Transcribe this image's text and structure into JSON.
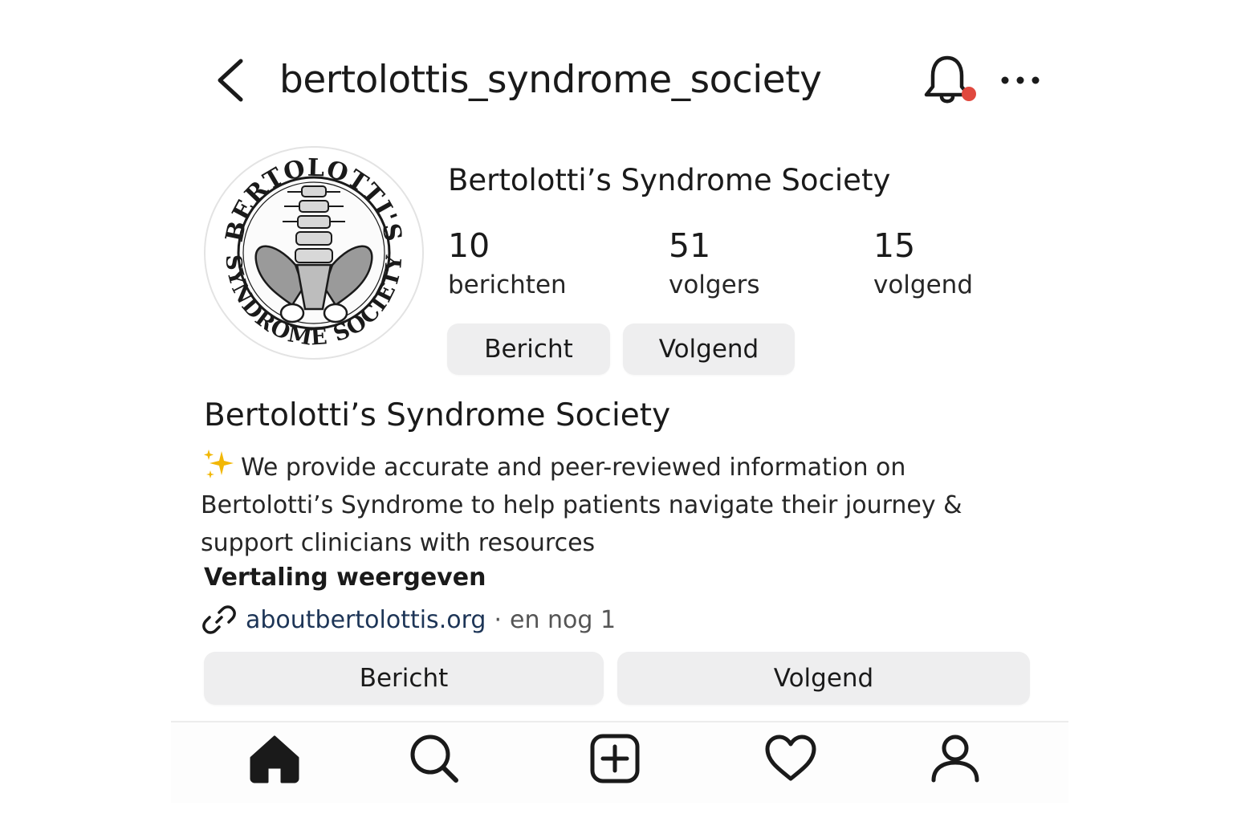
{
  "header": {
    "username": "bertolottis_syndrome_society",
    "back_icon": "chevron-left-icon",
    "bell_icon": "bell-icon",
    "more_icon": "more-horizontal-icon",
    "notification_dot_color": "#e0483e"
  },
  "profile": {
    "avatar_logo_text_top": "BERTOLOTTI'S",
    "avatar_logo_text_bottom": "SYNDROME SOCIETY",
    "display_name": "Bertolotti’s Syndrome Society",
    "stats": [
      {
        "value": "10",
        "label": "berichten"
      },
      {
        "value": "51",
        "label": "volgers"
      },
      {
        "value": "15",
        "label": "volgend"
      }
    ],
    "top_buttons": {
      "message_label": "Bericht",
      "follow_label": "Volgend"
    }
  },
  "bio": {
    "name": "Bertolotti’s Syndrome Society",
    "sparkle_icon": "sparkles-icon",
    "text": "We provide accurate and peer-reviewed information on Bertolotti’s Syndrome to help patients navigate their journey & support clinicians with resources",
    "translate_label": "Vertaling weergeven",
    "link_icon": "link-icon",
    "link_text": "aboutbertolottis.org",
    "link_separator": "·",
    "link_more": "en nog 1"
  },
  "actions": {
    "message_label": "Bericht",
    "follow_label": "Volgend"
  },
  "tabbar": {
    "items": [
      {
        "icon": "home-icon"
      },
      {
        "icon": "search-icon"
      },
      {
        "icon": "create-icon"
      },
      {
        "icon": "heart-icon"
      },
      {
        "icon": "profile-icon"
      }
    ]
  },
  "colors": {
    "button_bg": "#eeeeef",
    "link": "#1d3557",
    "notification_dot": "#e0483e",
    "sparkle": "#f2b705"
  }
}
